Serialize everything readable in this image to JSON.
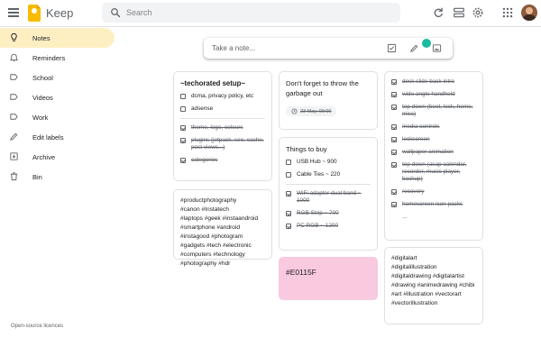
{
  "header": {
    "app_name": "Keep",
    "search_placeholder": "Search"
  },
  "sidebar": {
    "items": [
      {
        "label": "Notes",
        "icon": "lightbulb-icon",
        "active": true
      },
      {
        "label": "Reminders",
        "icon": "bell-icon"
      },
      {
        "label": "School",
        "icon": "label-icon"
      },
      {
        "label": "Videos",
        "icon": "label-icon"
      },
      {
        "label": "Work",
        "icon": "label-icon"
      },
      {
        "label": "Edit labels",
        "icon": "pencil-icon"
      },
      {
        "label": "Archive",
        "icon": "archive-icon"
      },
      {
        "label": "Bin",
        "icon": "trash-icon"
      }
    ],
    "footer": "Open-source licences"
  },
  "take_note": {
    "placeholder": "Take a note..."
  },
  "notes": {
    "techorated": {
      "title": "~techorated setup~",
      "unchecked": [
        "dcma, privacy policy, etc",
        "adsense"
      ],
      "checked": [
        "theme, logo, colours",
        "plugins (jetpack, seo, cache, post views...)",
        "categories"
      ]
    },
    "hashtags": {
      "text": "#productphotography\n#canon #Instatech\n#laptops #geek #instaandroid\n#smartphone #android\n#instagood #photogram\n#gadgets #tech #electronic\n#computers #technology\n#photography #hdr"
    },
    "garbage": {
      "title": "Don't forget to throw the garbage out",
      "reminder": "23 May, 09:00"
    },
    "things": {
      "title": "Things to buy",
      "unchecked": [
        "USB Hub ~ 900",
        "Cable Ties ~ 220"
      ],
      "checked": [
        "WiFi adapter dual band ~ 1000",
        "RGB Strip ~ 700",
        "PC RGB ~ 1200"
      ]
    },
    "color": {
      "title": "#E0115F"
    },
    "video": {
      "checked": [
        "desk slide back intro",
        "wide angle handheld",
        "top down (boot, lock, home, misc)",
        "media controls",
        "lockscreen",
        "wallpaper animation",
        "top down (asap calendar, recorder, music player, backup)",
        "recovery",
        "homescreen icon packs"
      ],
      "more": "..."
    },
    "digitalart": {
      "text": "#digitalart\n#digitalillustration\n#digitaldrawing #digitalartist\n#drawing #animedrawing #chibi\n#art #illustration #vectorart\n#vectorillustration"
    }
  },
  "colors": {
    "accent": "#f9bb00",
    "active_nav": "#feefc3",
    "pink_note": "#f9c9df"
  }
}
